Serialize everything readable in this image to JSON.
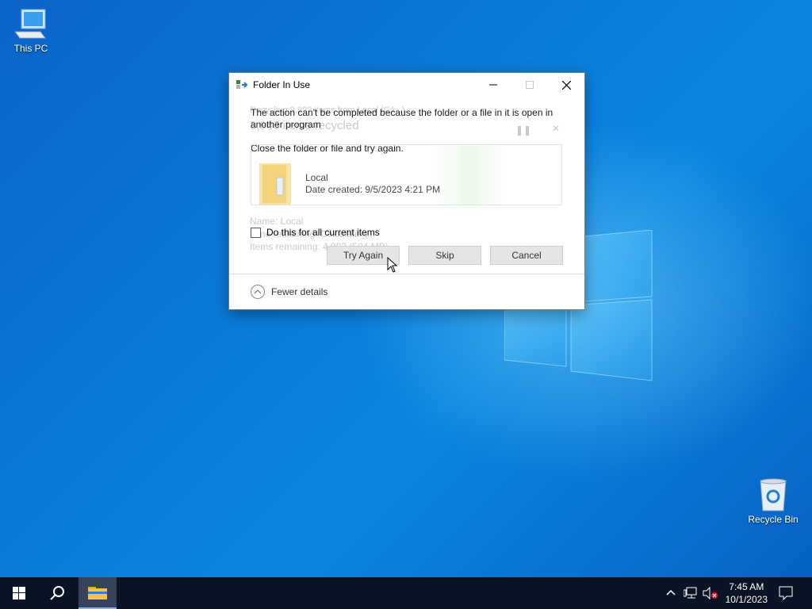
{
  "desktop": {
    "this_pc_label": "This PC",
    "recycle_bin_label": "Recycle Bin"
  },
  "ghost_progress": {
    "header": "Recycling 9,8?? items from Local (C:\\...)",
    "title": "3,943 items recycled",
    "name_line": "Name:  Local",
    "time_line": "Time remaining:  Calculating...",
    "items_line": "Items remaining:  4,893 (504 MB)"
  },
  "dialog": {
    "title": "Folder In Use",
    "message": "The action can't be completed because the folder or a file in it is open in another program",
    "instruction": "Close the folder or file and try again.",
    "item": {
      "name": "Local",
      "date_created": "Date created: 9/5/2023 4:21 PM"
    },
    "checkbox_label": "Do this for all current items",
    "checkbox_checked": false,
    "buttons": {
      "try_again": "Try Again",
      "skip": "Skip",
      "cancel": "Cancel"
    },
    "details_toggle": "Fewer details"
  },
  "taskbar": {
    "time": "7:45 AM",
    "date": "10/1/2023"
  },
  "colors": {
    "desktop_blue": "#0a78d7",
    "taskbar": "#0b1424",
    "folder_yellow": "#f5d37a"
  }
}
